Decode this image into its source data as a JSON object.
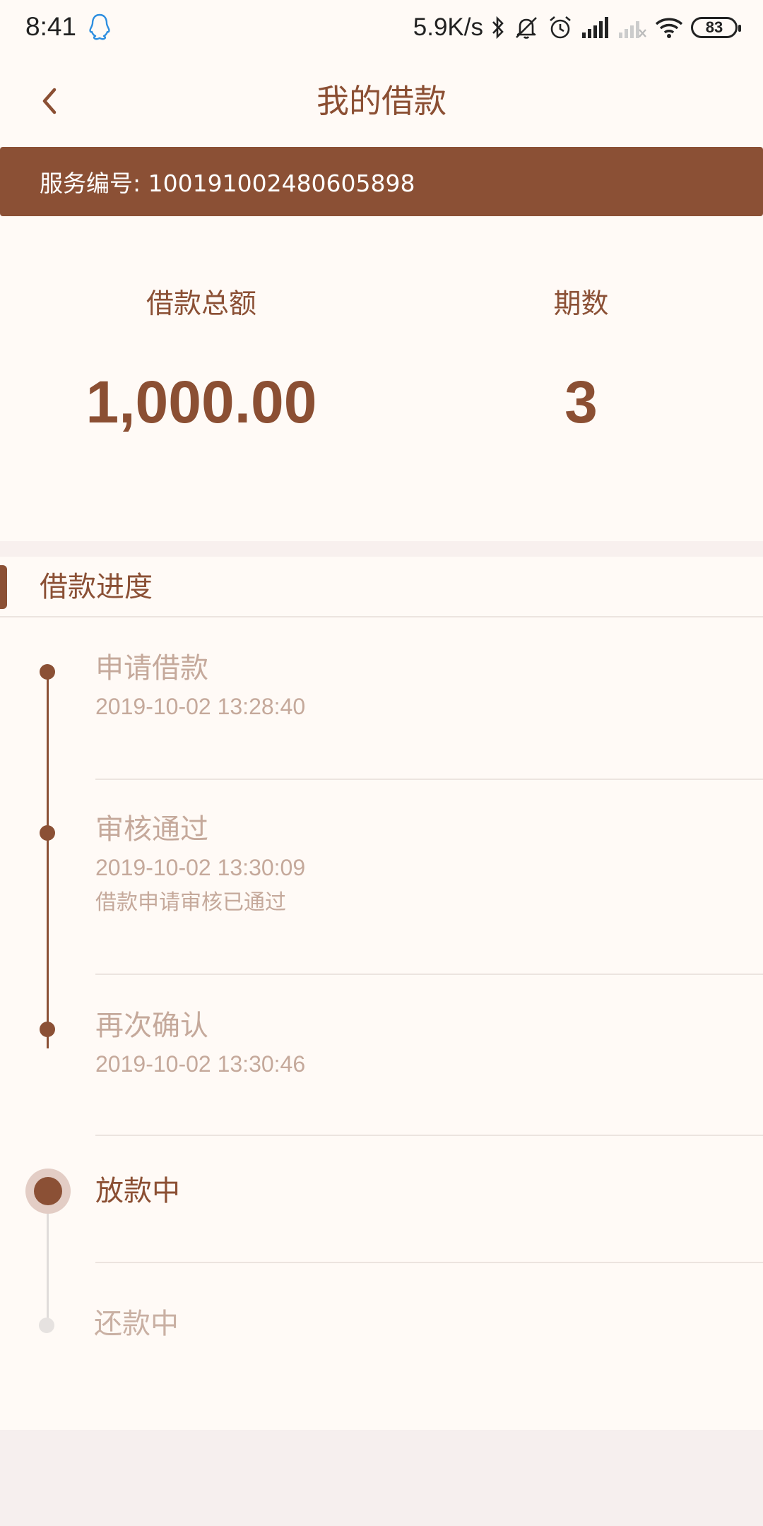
{
  "status_bar": {
    "time": "8:41",
    "net_speed": "5.9K/s",
    "battery": "83",
    "icons": [
      "qq-icon",
      "bluetooth-icon",
      "mute-icon",
      "alarm-icon",
      "signal-icon",
      "signal-empty-icon",
      "wifi-icon",
      "battery-icon"
    ]
  },
  "header": {
    "title": "我的借款",
    "back_icon": "chevron-left-icon"
  },
  "service": {
    "label": "服务编号: 100191002480605898"
  },
  "summary": {
    "total_label": "借款总额",
    "total_value": "1,000.00",
    "periods_label": "期数",
    "periods_value": "3"
  },
  "progress": {
    "title": "借款进度",
    "steps": [
      {
        "title": "申请借款",
        "time": "2019-10-02 13:28:40",
        "note": "",
        "state": "done"
      },
      {
        "title": "审核通过",
        "time": "2019-10-02 13:30:09",
        "note": "借款申请审核已通过",
        "state": "done"
      },
      {
        "title": "再次确认",
        "time": "2019-10-02 13:30:46",
        "note": "",
        "state": "done"
      },
      {
        "title": "放款中",
        "time": "",
        "note": "",
        "state": "current"
      },
      {
        "title": "还款中",
        "time": "",
        "note": "",
        "state": "pending"
      }
    ]
  },
  "colors": {
    "brand": "#8b5035",
    "background": "#fffaf6",
    "muted_text": "#c5a99b",
    "pending": "#e6e2e0"
  }
}
